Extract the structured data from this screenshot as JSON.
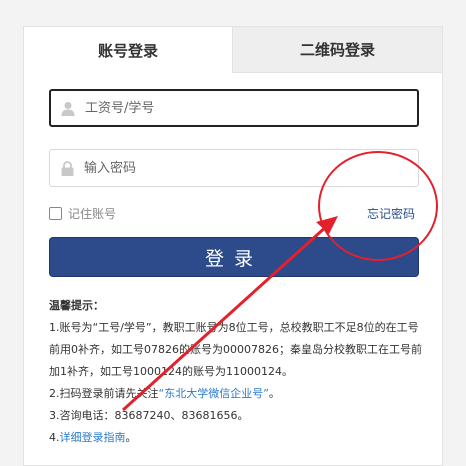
{
  "tabs": {
    "account_login": "账号登录",
    "qr_login": "二维码登录"
  },
  "form": {
    "username_placeholder": "工资号/学号",
    "password_placeholder": "输入密码",
    "remember_label": "记住账号",
    "forgot_label": "忘记密码",
    "login_label": "登录"
  },
  "tips": {
    "title": "温馨提示：",
    "line1": "1.账号为“工号/学号”，教职工账号为8位工号，总校教职工不足8位的在工号前用0补齐，如工号07826的账号为00007826；秦皇岛分校教职工在工号前加1补齐，如工号1000124的账号为11000124。",
    "line2_prefix": "2.扫码登录前请先关注",
    "line2_link": "“东北大学微信企业号”",
    "line2_suffix": "。",
    "line3": "3.咨询电话：83687240、83681656。",
    "line4_prefix": "4.",
    "line4_link": "详细登录指南",
    "line4_suffix": "。"
  },
  "colors": {
    "brand_button": "#2d4a8a",
    "link": "#2a7ac9",
    "annotation_red": "#e3202b"
  },
  "icons": {
    "user": "user-icon",
    "lock": "lock-icon"
  }
}
